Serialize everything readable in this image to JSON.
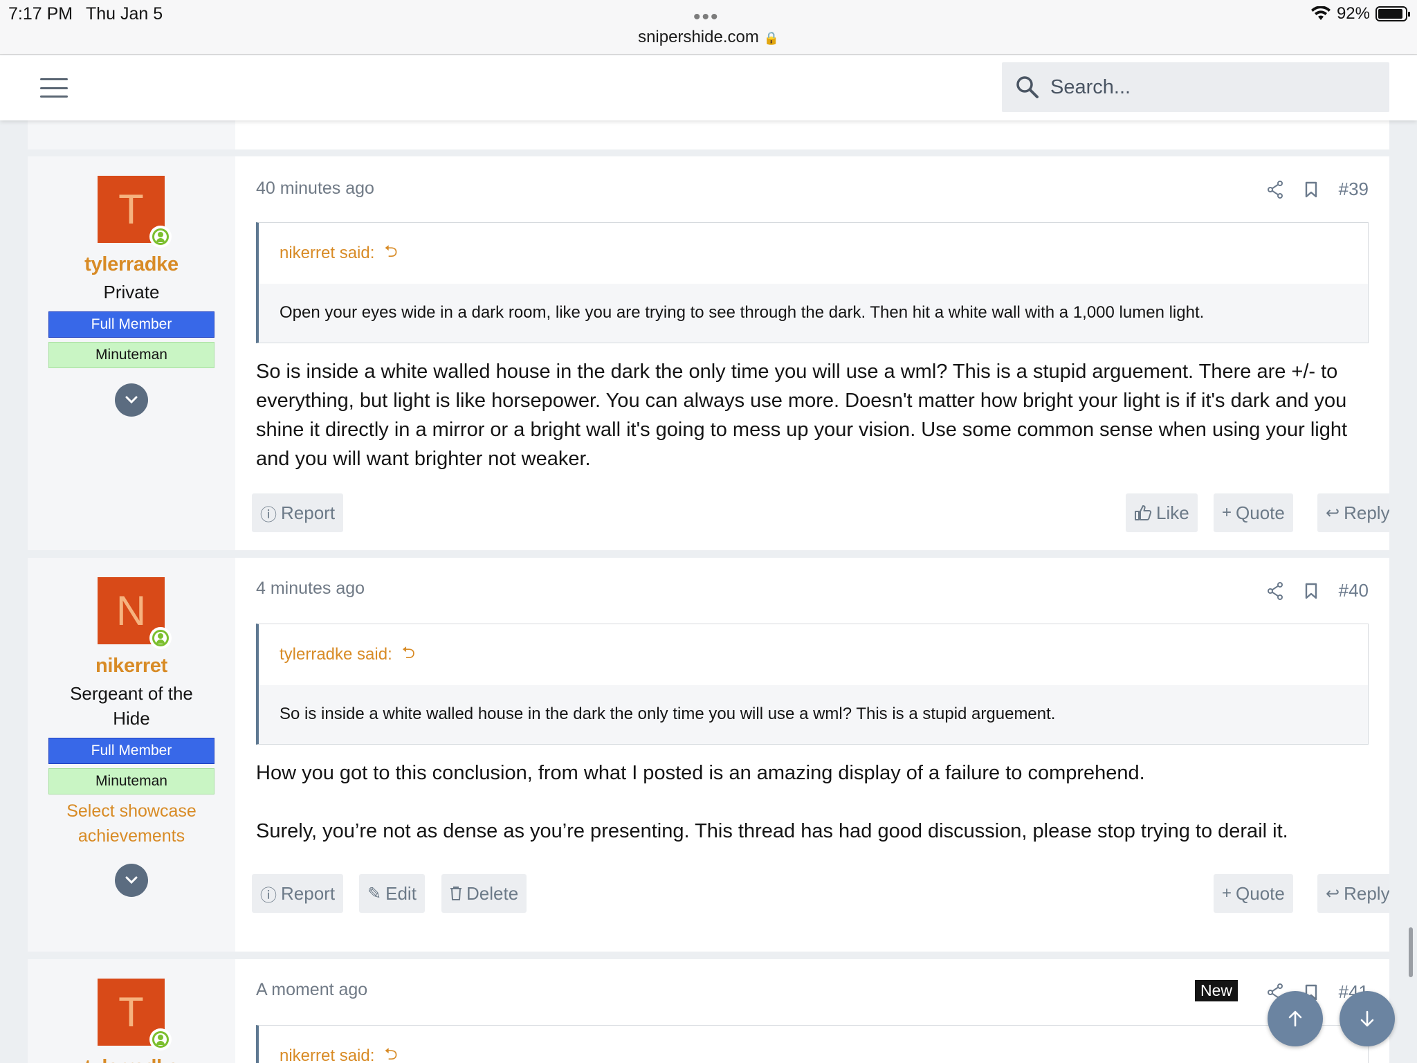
{
  "status_bar": {
    "time": "7:17 PM",
    "date": "Thu Jan 5",
    "url": "snipershide.com",
    "battery": "92%",
    "battery_level": 0.92
  },
  "header": {
    "search_placeholder": "Search..."
  },
  "posts": [
    {
      "avatar_letter": "T",
      "username": "tylerradke",
      "title": "Private",
      "banners": [
        "Full Member",
        "Minuteman"
      ],
      "time": "40 minutes ago",
      "number": "#39",
      "quote_author": "nikerret said:",
      "quote_text": "Open your eyes wide in a dark room, like you are trying to see through the dark. Then hit a white wall with a 1,000 lumen light.",
      "message": "So is inside a white walled house in the dark the only time you will use a wml? This is a stupid arguement. There are +/- to everything, but light is like horsepower. You can always use more. Doesn't matter how bright your light is if it's dark and you shine it directly in a mirror or a bright wall it's going to mess up your vision. Use some common sense when using your light and you will want brighter not weaker.",
      "buttons": {
        "report": "Report",
        "like": "Like",
        "quote": "Quote",
        "reply": "Reply"
      }
    },
    {
      "avatar_letter": "N",
      "username": "nikerret",
      "title": "Sergeant of the Hide",
      "banners": [
        "Full Member",
        "Minuteman"
      ],
      "showcase": "Select showcase achievements",
      "time": "4 minutes ago",
      "number": "#40",
      "quote_author": "tylerradke said:",
      "quote_text": "So is inside a white walled house in the dark the only time you will use a wml? This is a stupid arguement.",
      "message_p1": "How you got to this conclusion, from what I posted is an amazing display of a failure to comprehend.",
      "message_p2": "Surely, you’re not as dense as you’re presenting. This thread has had good discussion, please stop trying to derail it.",
      "buttons": {
        "report": "Report",
        "edit": "Edit",
        "delete": "Delete",
        "quote": "Quote",
        "reply": "Reply"
      }
    },
    {
      "avatar_letter": "T",
      "username": "tylerradke",
      "time": "A moment ago",
      "number": "#41",
      "badge": "New",
      "quote_author": "nikerret said:"
    }
  ],
  "colors": {
    "accent": "#d88b26",
    "full_member": "#3868e8",
    "minuteman": "#c9f5c4",
    "avatar": "#d84a18",
    "fab": "#6b84a1"
  }
}
